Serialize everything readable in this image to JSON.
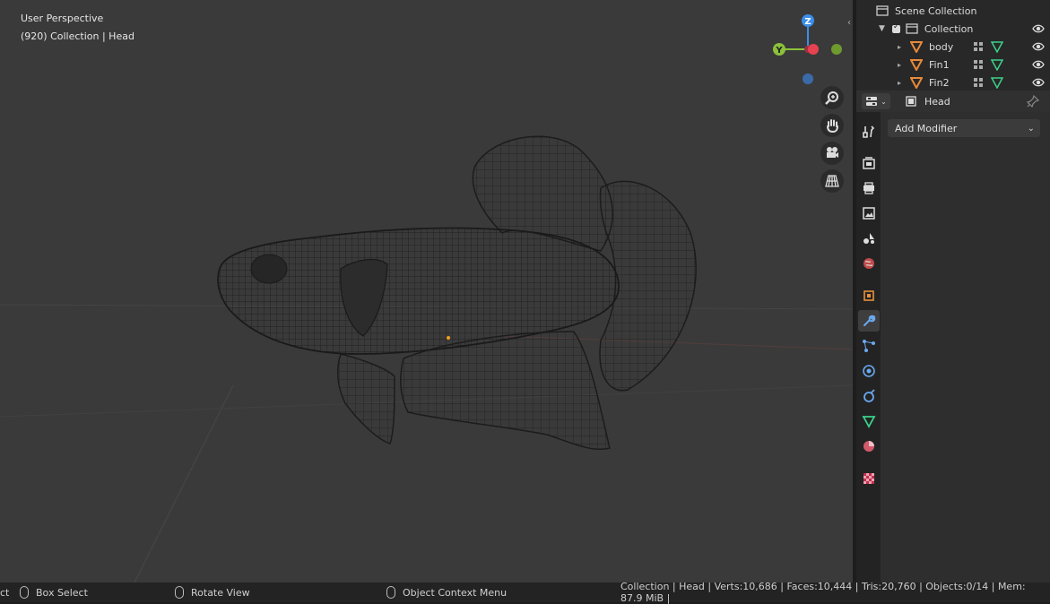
{
  "viewport": {
    "perspective_label": "User Perspective",
    "collection_label": "(920) Collection | Head",
    "gizmo": {
      "z": "Z",
      "y": "Y"
    }
  },
  "outliner": {
    "scene_collection": "Scene Collection",
    "collection": "Collection",
    "objects": [
      "body",
      "Fin1",
      "Fin2"
    ]
  },
  "properties": {
    "object_name": "Head",
    "add_modifier": "Add Modifier"
  },
  "statusbar": {
    "select_label": "ct",
    "box_select": "Box Select",
    "rotate_view": "Rotate View",
    "context_menu": "Object Context Menu",
    "stats": "Collection | Head | Verts:10,686 | Faces:10,444 | Tris:20,760 | Objects:0/14 | Mem: 87.9 MiB |"
  },
  "colors": {
    "viewport_bg": "#3a3a3a",
    "axis_x": "#e8414f",
    "axis_y": "#8bc13b",
    "axis_z": "#3b8ee8",
    "mesh_icon": "#e88a3a",
    "data_icon": "#3bd28b"
  }
}
